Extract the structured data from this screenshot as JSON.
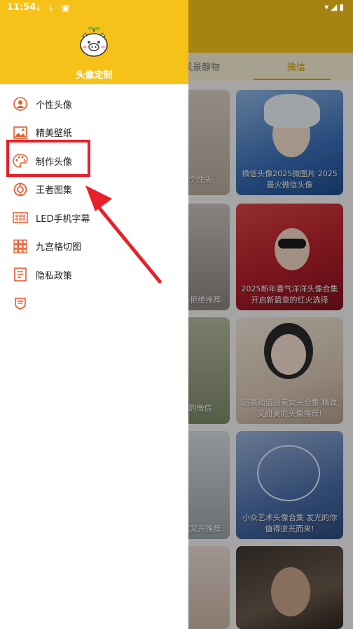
{
  "status_bar": {
    "time": "11:54",
    "icons": [
      "download-icon",
      "download-icon",
      "app-icon"
    ],
    "right_icons": "▾◢▮"
  },
  "background": {
    "tabs": [
      "风景静物",
      "微信"
    ],
    "cards": [
      {
        "caption": "有型个性头"
      },
      {
        "caption": "微信头像2025微图片 2025最火微信头像"
      },
      {
        "caption": "集 无法拒绝推荐"
      },
      {
        "caption": "2025新年喜气洋洋头像合集 开启新篇章的红火选择"
      },
      {
        "caption": "最火的微信"
      },
      {
        "caption": "超高颜值甜美女头合集 精致又甜美的头像推荐!"
      },
      {
        "caption": "集 真实又开推荐"
      },
      {
        "caption": "小众艺术头像合集 发光的你值得逆光而来!"
      }
    ]
  },
  "drawer": {
    "title": "头像定制",
    "menu": [
      {
        "label": "个性头像",
        "icon": "avatar-icon"
      },
      {
        "label": "精美壁纸",
        "icon": "image-icon"
      },
      {
        "label": "制作头像",
        "icon": "palette-icon"
      },
      {
        "label": "王者图集",
        "icon": "king-icon"
      },
      {
        "label": "LED手机字幕",
        "icon": "led-icon"
      },
      {
        "label": "九宫格切图",
        "icon": "grid-icon"
      },
      {
        "label": "隐私政策",
        "icon": "document-icon"
      },
      {
        "label": "",
        "icon": "badge-icon"
      }
    ]
  },
  "colors": {
    "accent": "#f6c21a",
    "icon": "#e85a2c",
    "highlight": "#e8202a"
  }
}
